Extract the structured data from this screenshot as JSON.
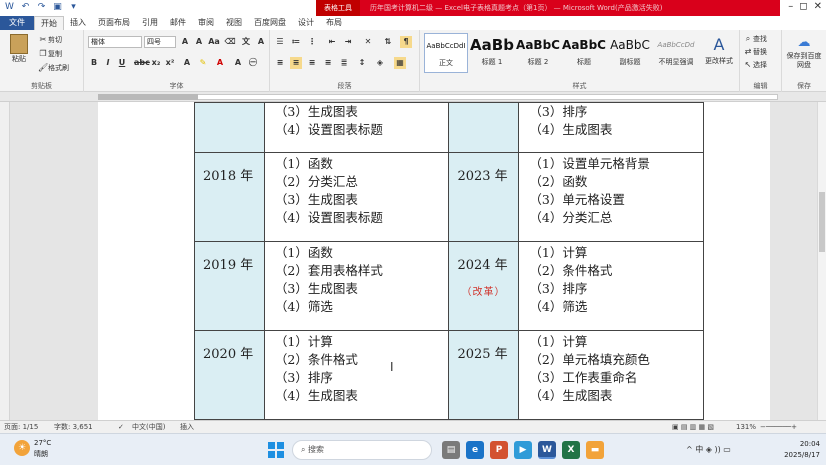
{
  "titlebar": {
    "tool_tab": "表格工具",
    "doc_title": "历年国考计算机二级 — Excel电子表格真题考点（第1页） — Microsoft Word(产品激活失败)"
  },
  "tabs": [
    "文件",
    "开始",
    "插入",
    "页面布局",
    "引用",
    "邮件",
    "审阅",
    "视图",
    "百度网盘",
    "设计",
    "布局"
  ],
  "ribbon": {
    "clipboard": {
      "paste": "粘贴",
      "cut": "剪切",
      "copy": "复制",
      "format_painter": "格式刷",
      "label": "剪贴板"
    },
    "font": {
      "name": "楷体",
      "size": "四号",
      "label": "字体"
    },
    "paragraph": {
      "label": "段落"
    },
    "styles": {
      "items": [
        {
          "sample": "AaBbCcDdI",
          "name": "正文"
        },
        {
          "sample": "AaBb",
          "name": "标题 1"
        },
        {
          "sample": "AaBbC",
          "name": "标题 2"
        },
        {
          "sample": "AaBbC",
          "name": "标题"
        },
        {
          "sample": "AaBbC",
          "name": "副标题"
        },
        {
          "sample": "AaBbCcDd",
          "name": "不明显强调"
        }
      ],
      "change_styles": "更改样式",
      "label": "样式"
    },
    "editing": {
      "find": "查找",
      "replace": "替换",
      "select": "选择",
      "label": "编辑"
    },
    "save": {
      "button": "保存到百度网盘",
      "label": "保存"
    }
  },
  "table": {
    "partial_row": {
      "left_items": [
        "（3）生成图表",
        "（4）设置图表标题"
      ],
      "right_items": [
        "（3）排序",
        "（4）生成图表"
      ]
    },
    "rows": [
      {
        "left_year": "2018 年",
        "left_items": [
          "（1）函数",
          "（2）分类汇总",
          "（3）生成图表",
          "（4）设置图表标题"
        ],
        "right_year": "2023 年",
        "right_note": "",
        "right_items": [
          "（1）设置单元格背景",
          "（2）函数",
          "（3）单元格设置",
          "（4）分类汇总"
        ]
      },
      {
        "left_year": "2019 年",
        "left_items": [
          "（1）函数",
          "（2）套用表格样式",
          "（3）生成图表",
          "（4）筛选"
        ],
        "right_year": "2024 年",
        "right_note": "（改革）",
        "right_items": [
          "（1）计算",
          "（2）条件格式",
          "（3）排序",
          "（4）筛选"
        ]
      },
      {
        "left_year": "2020 年",
        "left_items": [
          "（1）计算",
          "（2）条件格式",
          "（3）排序",
          "（4）生成图表"
        ],
        "right_year": "2025 年",
        "right_note": "",
        "right_items": [
          "（1）计算",
          "（2）单元格填充颜色",
          "（3）工作表重命名",
          "（4）生成图表"
        ]
      }
    ]
  },
  "statusbar": {
    "page": "页面: 1/15",
    "words": "字数: 3,651",
    "language": "中文(中国)",
    "mode": "插入",
    "zoom": "131%"
  },
  "taskbar": {
    "temperature": "27°C",
    "weather": "晴朗",
    "search_placeholder": "搜索",
    "tray": "^  中  ◈  ))  ▭",
    "time": "20:04",
    "date": "2025/8/17"
  }
}
